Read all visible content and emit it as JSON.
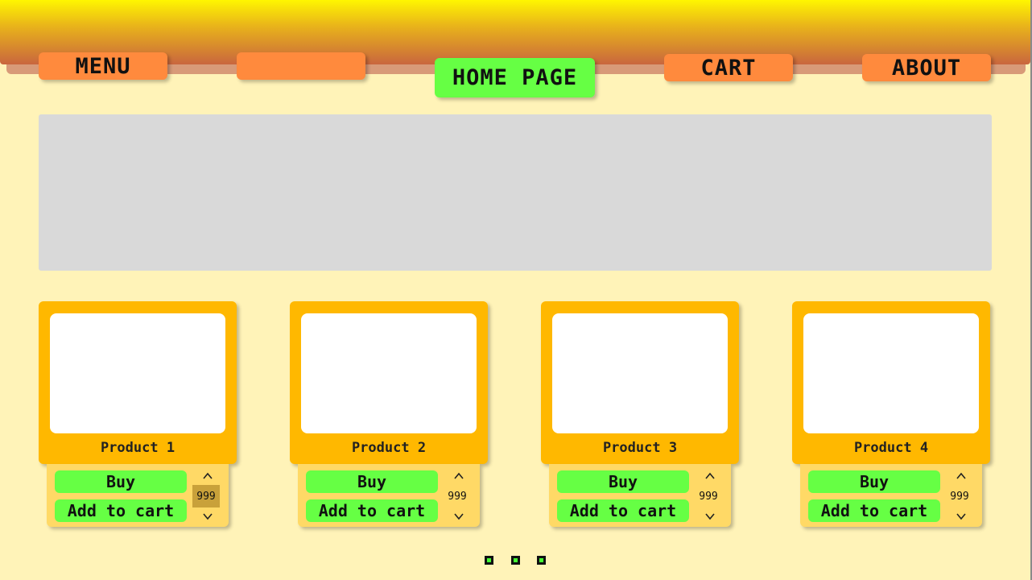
{
  "nav": {
    "menu": "MENU",
    "blank": "",
    "home": "HOME PAGE",
    "cart": "CART",
    "about": "ABOUT"
  },
  "products": [
    {
      "title": "Product 1",
      "buy": "Buy",
      "add": "Add to cart",
      "qty": "999"
    },
    {
      "title": "Product 2",
      "buy": "Buy",
      "add": "Add to cart",
      "qty": "999"
    },
    {
      "title": "Product 3",
      "buy": "Buy",
      "add": "Add to cart",
      "qty": "999"
    },
    {
      "title": "Product 4",
      "buy": "Buy",
      "add": "Add to cart",
      "qty": "999"
    }
  ],
  "icons": {
    "qty_up": "chevron-up-icon",
    "qty_down": "chevron-down-icon"
  },
  "colors": {
    "background": "#fff3b8",
    "nav_button": "#ff8a3d",
    "active_button": "#66ff44",
    "card": "#ffb800",
    "card_actions": "#ffd966",
    "banner": "#d9d9d9"
  }
}
